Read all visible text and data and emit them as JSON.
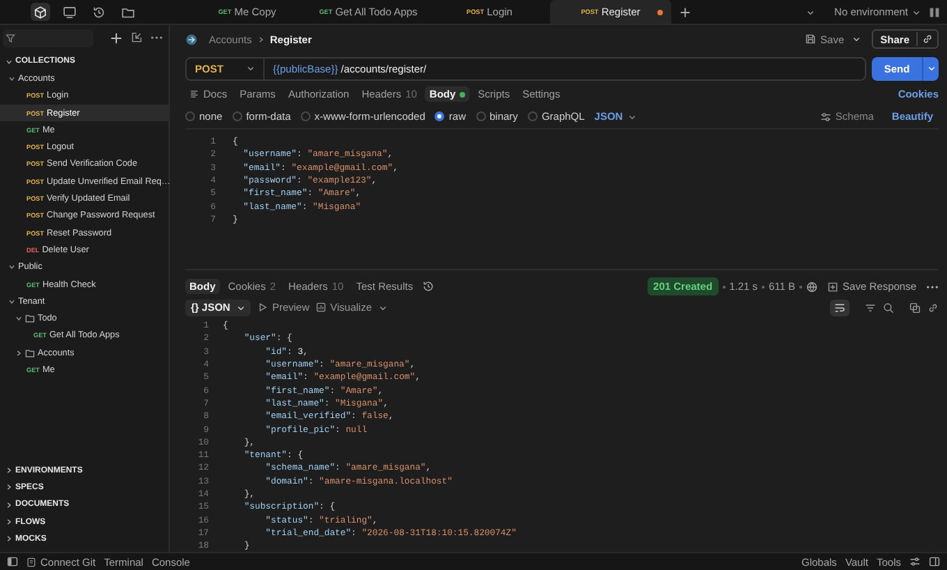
{
  "rail": [
    {
      "kind": "cube",
      "selected": true
    },
    {
      "kind": "monitor",
      "selected": false
    },
    {
      "kind": "history",
      "selected": false
    },
    {
      "kind": "folder",
      "selected": false
    }
  ],
  "tabs": [
    {
      "method": "GET",
      "title": "Me Copy",
      "selected": false,
      "modified": false
    },
    {
      "method": "GET",
      "title": "Get All Todo Apps",
      "selected": false,
      "modified": false
    },
    {
      "method": "POST",
      "title": "Login",
      "selected": false,
      "modified": false
    },
    {
      "method": "POST",
      "title": "Register",
      "selected": true,
      "modified": true
    }
  ],
  "environment": "No environment",
  "sidebar": {
    "collections_label": "COLLECTIONS",
    "collections_expanded": true,
    "tree": [
      {
        "kind": "collection",
        "name": "Accounts",
        "expanded": true,
        "children": [
          {
            "kind": "request",
            "method": "POST",
            "name": "Login",
            "selected": false
          },
          {
            "kind": "request",
            "method": "POST",
            "name": "Register",
            "selected": true
          },
          {
            "kind": "request",
            "method": "GET",
            "name": "Me",
            "selected": false
          },
          {
            "kind": "request",
            "method": "POST",
            "name": "Logout",
            "selected": false
          },
          {
            "kind": "request",
            "method": "POST",
            "name": "Send Verification Code",
            "selected": false
          },
          {
            "kind": "request",
            "method": "POST",
            "name": "Update Unverified Email Req…",
            "selected": false
          },
          {
            "kind": "request",
            "method": "POST",
            "name": "Verify Updated Email",
            "selected": false
          },
          {
            "kind": "request",
            "method": "POST",
            "name": "Change Password Request",
            "selected": false
          },
          {
            "kind": "request",
            "method": "POST",
            "name": "Reset Password",
            "selected": false
          },
          {
            "kind": "request",
            "method": "DEL",
            "name": "Delete User",
            "selected": false
          }
        ]
      },
      {
        "kind": "collection",
        "name": "Public",
        "expanded": true,
        "children": [
          {
            "kind": "request",
            "method": "GET",
            "name": "Health Check",
            "selected": false
          }
        ]
      },
      {
        "kind": "collection",
        "name": "Tenant",
        "expanded": true,
        "children": [
          {
            "kind": "folder",
            "name": "Todo",
            "expanded": true,
            "children": [
              {
                "kind": "request",
                "method": "GET",
                "name": "Get All Todo Apps",
                "selected": false
              }
            ]
          },
          {
            "kind": "folder",
            "name": "Accounts",
            "expanded": false
          },
          {
            "kind": "request",
            "method": "GET",
            "name": "Me",
            "selected": false
          }
        ]
      }
    ],
    "sections": [
      {
        "label": "ENVIRONMENTS",
        "expanded": false
      },
      {
        "label": "SPECS",
        "expanded": false
      },
      {
        "label": "DOCUMENTS",
        "expanded": false
      },
      {
        "label": "FLOWS",
        "expanded": false
      },
      {
        "label": "MOCKS",
        "expanded": false
      }
    ]
  },
  "breadcrumb": {
    "parent": "Accounts",
    "current": "Register"
  },
  "save_label": "Save",
  "share_label": "Share",
  "request": {
    "method": "POST",
    "url_variable": "{{publicBase}}",
    "url_path": "/accounts/register/",
    "send_label": "Send"
  },
  "request_tabs": [
    {
      "label": "Docs",
      "selected": false,
      "indicator": false
    },
    {
      "label": "Params",
      "selected": false,
      "indicator": false
    },
    {
      "label": "Authorization",
      "selected": false,
      "indicator": false
    },
    {
      "label": "Headers",
      "count": "10",
      "selected": false,
      "indicator": false
    },
    {
      "label": "Body",
      "selected": true,
      "indicator": true
    },
    {
      "label": "Scripts",
      "selected": false,
      "indicator": false
    },
    {
      "label": "Settings",
      "selected": false,
      "indicator": false
    }
  ],
  "cookies_link": "Cookies",
  "body_types": [
    {
      "label": "none",
      "selected": false
    },
    {
      "label": "form-data",
      "selected": false
    },
    {
      "label": "x-www-form-urlencoded",
      "selected": false
    },
    {
      "label": "raw",
      "selected": true
    },
    {
      "label": "binary",
      "selected": false
    },
    {
      "label": "GraphQL",
      "selected": false
    }
  ],
  "body_format": "JSON",
  "schema_label": "Schema",
  "beautify_label": "Beautify",
  "request_body": [
    {
      "n": "1",
      "t": [
        {
          "kind": "p",
          "text": "{"
        }
      ]
    },
    {
      "n": "2",
      "t": [
        {
          "kind": "k",
          "text": "  \"username\""
        },
        {
          "kind": "p",
          "text": ": "
        },
        {
          "kind": "s",
          "text": "\"amare_misgana\""
        },
        {
          "kind": "p",
          "text": ","
        }
      ]
    },
    {
      "n": "3",
      "t": [
        {
          "kind": "k",
          "text": "  \"email\""
        },
        {
          "kind": "p",
          "text": ": "
        },
        {
          "kind": "s",
          "text": "\"example@gmail.com\""
        },
        {
          "kind": "p",
          "text": ","
        }
      ]
    },
    {
      "n": "4",
      "t": [
        {
          "kind": "k",
          "text": "  \"password\""
        },
        {
          "kind": "p",
          "text": ": "
        },
        {
          "kind": "s",
          "text": "\"example123\""
        },
        {
          "kind": "p",
          "text": ","
        }
      ]
    },
    {
      "n": "5",
      "t": [
        {
          "kind": "k",
          "text": "  \"first_name\""
        },
        {
          "kind": "p",
          "text": ": "
        },
        {
          "kind": "s",
          "text": "\"Amare\""
        },
        {
          "kind": "p",
          "text": ","
        }
      ]
    },
    {
      "n": "6",
      "t": [
        {
          "kind": "k",
          "text": "  \"last_name\""
        },
        {
          "kind": "p",
          "text": ": "
        },
        {
          "kind": "s",
          "text": "\"Misgana\""
        }
      ]
    },
    {
      "n": "7",
      "t": [
        {
          "kind": "p",
          "text": "}"
        }
      ]
    }
  ],
  "response": {
    "tabs": [
      {
        "label": "Body",
        "selected": true
      },
      {
        "label": "Cookies",
        "count": "2",
        "selected": false
      },
      {
        "label": "Headers",
        "count": "10",
        "selected": false
      },
      {
        "label": "Test Results",
        "selected": false
      }
    ],
    "status": "201 Created",
    "time": "1.21 s",
    "size": "611 B",
    "save_label": "Save Response",
    "view_format_icon": "{}",
    "view_format": "JSON",
    "preview_label": "Preview",
    "visualize_label": "Visualize",
    "lines": [
      {
        "n": "1",
        "t": [
          {
            "kind": "p",
            "text": "{"
          }
        ]
      },
      {
        "n": "2",
        "t": [
          {
            "kind": "k",
            "text": "    \"user\""
          },
          {
            "kind": "p",
            "text": ": {"
          }
        ]
      },
      {
        "n": "3",
        "t": [
          {
            "kind": "k",
            "text": "        \"id\""
          },
          {
            "kind": "p",
            "text": ": "
          },
          {
            "kind": "n",
            "text": "3"
          },
          {
            "kind": "p",
            "text": ","
          }
        ]
      },
      {
        "n": "4",
        "t": [
          {
            "kind": "k",
            "text": "        \"username\""
          },
          {
            "kind": "p",
            "text": ": "
          },
          {
            "kind": "s",
            "text": "\"amare_misgana\""
          },
          {
            "kind": "p",
            "text": ","
          }
        ]
      },
      {
        "n": "5",
        "t": [
          {
            "kind": "k",
            "text": "        \"email\""
          },
          {
            "kind": "p",
            "text": ": "
          },
          {
            "kind": "s",
            "text": "\"example@gmail.com\""
          },
          {
            "kind": "p",
            "text": ","
          }
        ]
      },
      {
        "n": "6",
        "t": [
          {
            "kind": "k",
            "text": "        \"first_name\""
          },
          {
            "kind": "p",
            "text": ": "
          },
          {
            "kind": "s",
            "text": "\"Amare\""
          },
          {
            "kind": "p",
            "text": ","
          }
        ]
      },
      {
        "n": "7",
        "t": [
          {
            "kind": "k",
            "text": "        \"last_name\""
          },
          {
            "kind": "p",
            "text": ": "
          },
          {
            "kind": "s",
            "text": "\"Misgana\""
          },
          {
            "kind": "p",
            "text": ","
          }
        ]
      },
      {
        "n": "8",
        "t": [
          {
            "kind": "k",
            "text": "        \"email_verified\""
          },
          {
            "kind": "p",
            "text": ": "
          },
          {
            "kind": "l",
            "text": "false"
          },
          {
            "kind": "p",
            "text": ","
          }
        ]
      },
      {
        "n": "9",
        "t": [
          {
            "kind": "k",
            "text": "        \"profile_pic\""
          },
          {
            "kind": "p",
            "text": ": "
          },
          {
            "kind": "l",
            "text": "null"
          }
        ]
      },
      {
        "n": "10",
        "t": [
          {
            "kind": "p",
            "text": "    },"
          }
        ]
      },
      {
        "n": "11",
        "t": [
          {
            "kind": "k",
            "text": "    \"tenant\""
          },
          {
            "kind": "p",
            "text": ": {"
          }
        ]
      },
      {
        "n": "12",
        "t": [
          {
            "kind": "k",
            "text": "        \"schema_name\""
          },
          {
            "kind": "p",
            "text": ": "
          },
          {
            "kind": "s",
            "text": "\"amare_misgana\""
          },
          {
            "kind": "p",
            "text": ","
          }
        ]
      },
      {
        "n": "13",
        "t": [
          {
            "kind": "k",
            "text": "        \"domain\""
          },
          {
            "kind": "p",
            "text": ": "
          },
          {
            "kind": "s",
            "text": "\"amare-misgana.localhost\""
          }
        ]
      },
      {
        "n": "14",
        "t": [
          {
            "kind": "p",
            "text": "    },"
          }
        ]
      },
      {
        "n": "15",
        "t": [
          {
            "kind": "k",
            "text": "    \"subscription\""
          },
          {
            "kind": "p",
            "text": ": {"
          }
        ]
      },
      {
        "n": "16",
        "t": [
          {
            "kind": "k",
            "text": "        \"status\""
          },
          {
            "kind": "p",
            "text": ": "
          },
          {
            "kind": "s",
            "text": "\"trialing\""
          },
          {
            "kind": "p",
            "text": ","
          }
        ]
      },
      {
        "n": "17",
        "t": [
          {
            "kind": "k",
            "text": "        \"trial_end_date\""
          },
          {
            "kind": "p",
            "text": ": "
          },
          {
            "kind": "s",
            "text": "\"2026-08-31T18:10:15.820074Z\""
          }
        ]
      },
      {
        "n": "18",
        "t": [
          {
            "kind": "p",
            "text": "    }"
          }
        ]
      }
    ]
  },
  "status_bar": {
    "connect_git": "Connect Git",
    "terminal": "Terminal",
    "console": "Console",
    "right": [
      "Globals",
      "Vault",
      "Tools"
    ]
  }
}
